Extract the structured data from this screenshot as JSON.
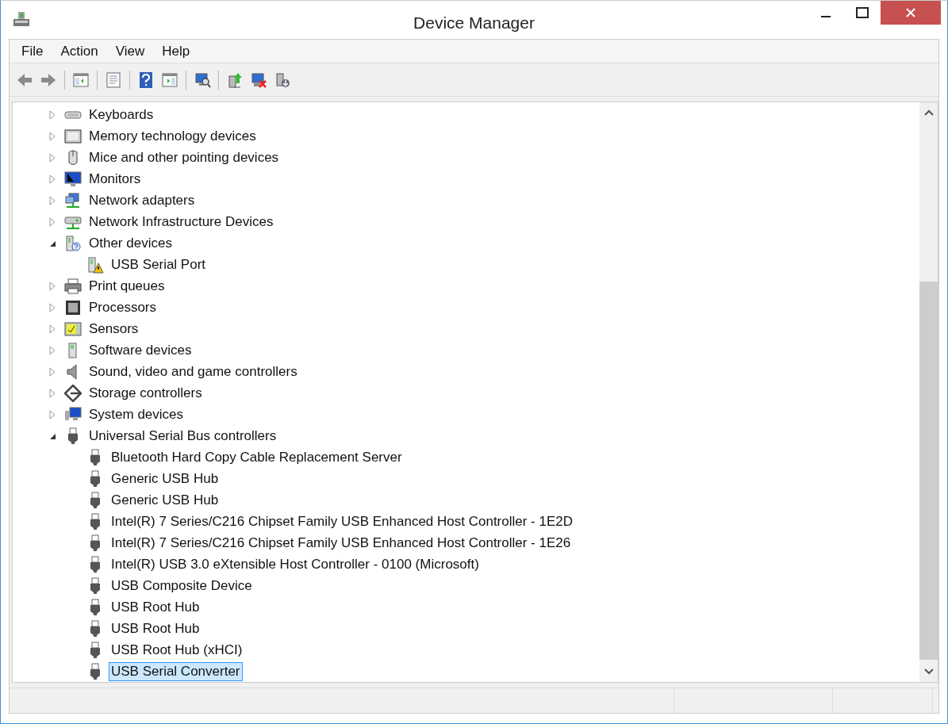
{
  "window": {
    "title": "Device Manager"
  },
  "menu": [
    "File",
    "Action",
    "View",
    "Help"
  ],
  "toolbar": [
    {
      "kind": "back"
    },
    {
      "kind": "forward"
    },
    {
      "kind": "sep"
    },
    {
      "kind": "tree"
    },
    {
      "kind": "sep"
    },
    {
      "kind": "properties"
    },
    {
      "kind": "sep"
    },
    {
      "kind": "help"
    },
    {
      "kind": "pane"
    },
    {
      "kind": "sep"
    },
    {
      "kind": "scan"
    },
    {
      "kind": "sep"
    },
    {
      "kind": "update"
    },
    {
      "kind": "uninstall"
    },
    {
      "kind": "disable"
    }
  ],
  "tree": [
    {
      "label": "Keyboards",
      "kind": "keyboard",
      "expanded": false,
      "selected": false
    },
    {
      "label": "Memory technology devices",
      "kind": "memory",
      "expanded": false,
      "selected": false
    },
    {
      "label": "Mice and other pointing devices",
      "kind": "mouse",
      "expanded": false,
      "selected": false
    },
    {
      "label": "Monitors",
      "kind": "monitor",
      "expanded": false,
      "selected": false
    },
    {
      "label": "Network adapters",
      "kind": "network",
      "expanded": false,
      "selected": false
    },
    {
      "label": "Network Infrastructure Devices",
      "kind": "infrastructure",
      "expanded": false,
      "selected": false
    },
    {
      "label": "Other devices",
      "kind": "unknown",
      "expanded": true,
      "selected": false,
      "children": [
        {
          "label": "USB Serial Port",
          "kind": "warning",
          "selected": false
        }
      ]
    },
    {
      "label": "Print queues",
      "kind": "printer",
      "expanded": false,
      "selected": false
    },
    {
      "label": "Processors",
      "kind": "processor",
      "expanded": false,
      "selected": false
    },
    {
      "label": "Sensors",
      "kind": "sensor",
      "expanded": false,
      "selected": false
    },
    {
      "label": "Software devices",
      "kind": "software",
      "expanded": false,
      "selected": false
    },
    {
      "label": "Sound, video and game controllers",
      "kind": "sound",
      "expanded": false,
      "selected": false
    },
    {
      "label": "Storage controllers",
      "kind": "storage",
      "expanded": false,
      "selected": false
    },
    {
      "label": "System devices",
      "kind": "system",
      "expanded": false,
      "selected": false
    },
    {
      "label": "Universal Serial Bus controllers",
      "kind": "usb",
      "expanded": true,
      "selected": false,
      "children": [
        {
          "label": "Bluetooth Hard Copy Cable Replacement Server",
          "kind": "usb",
          "selected": false
        },
        {
          "label": "Generic USB Hub",
          "kind": "usb",
          "selected": false
        },
        {
          "label": "Generic USB Hub",
          "kind": "usb",
          "selected": false
        },
        {
          "label": "Intel(R) 7 Series/C216 Chipset Family USB Enhanced Host Controller - 1E2D",
          "kind": "usb",
          "selected": false
        },
        {
          "label": "Intel(R) 7 Series/C216 Chipset Family USB Enhanced Host Controller - 1E26",
          "kind": "usb",
          "selected": false
        },
        {
          "label": "Intel(R) USB 3.0 eXtensible Host Controller - 0100 (Microsoft)",
          "kind": "usb",
          "selected": false
        },
        {
          "label": "USB Composite Device",
          "kind": "usb",
          "selected": false
        },
        {
          "label": "USB Root Hub",
          "kind": "usb",
          "selected": false
        },
        {
          "label": "USB Root Hub",
          "kind": "usb",
          "selected": false
        },
        {
          "label": "USB Root Hub (xHCI)",
          "kind": "usb",
          "selected": false
        },
        {
          "label": "USB Serial Converter",
          "kind": "usb",
          "selected": true
        }
      ]
    }
  ]
}
